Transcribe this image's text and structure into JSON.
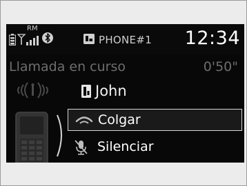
{
  "status_bar": {
    "roaming": "RM",
    "phone_name": "PHONE#1",
    "clock": "12:34",
    "icons": [
      "battery-icon",
      "signal-icon",
      "bluetooth-icon",
      "phone-profile-icon"
    ]
  },
  "call": {
    "status_label": "Llamada en curso",
    "timer": "0'50\"",
    "contact_name": "John"
  },
  "menu": {
    "items": [
      {
        "label": "Colgar",
        "icon": "hang-up-icon",
        "selected": true
      },
      {
        "label": "Silenciar",
        "icon": "mute-icon",
        "selected": false
      }
    ]
  }
}
